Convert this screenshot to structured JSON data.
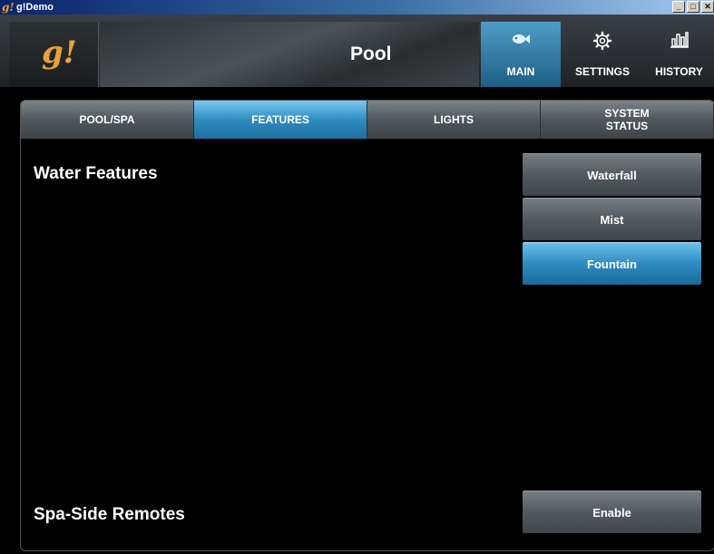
{
  "window": {
    "title": "g!Demo",
    "icon": "g!",
    "controls": {
      "minimize": "_",
      "maximize": "□",
      "close": "✕"
    }
  },
  "header": {
    "logo": "g!",
    "page_title": "Pool",
    "nav": [
      {
        "label": "MAIN",
        "icon": "fish-icon",
        "glyph": "🐟",
        "active": true
      },
      {
        "label": "SETTINGS",
        "icon": "gear-icon",
        "glyph": "⚙",
        "active": false
      },
      {
        "label": "HISTORY",
        "icon": "bar-chart-icon",
        "glyph": "📊",
        "active": false
      }
    ]
  },
  "tabs": [
    {
      "label": "POOL/SPA",
      "active": false
    },
    {
      "label": "FEATURES",
      "active": true
    },
    {
      "label": "LIGHTS",
      "active": false
    },
    {
      "label": "SYSTEM\nSTATUS",
      "active": false
    }
  ],
  "water_features": {
    "heading": "Water Features",
    "buttons": [
      {
        "label": "Waterfall",
        "on": false
      },
      {
        "label": "Mist",
        "on": false
      },
      {
        "label": "Fountain",
        "on": true
      }
    ]
  },
  "spa_side_remotes": {
    "heading": "Spa-Side Remotes",
    "button": "Enable"
  },
  "colors": {
    "accent": "#2f8cc0",
    "logo": "#e8a23a"
  }
}
